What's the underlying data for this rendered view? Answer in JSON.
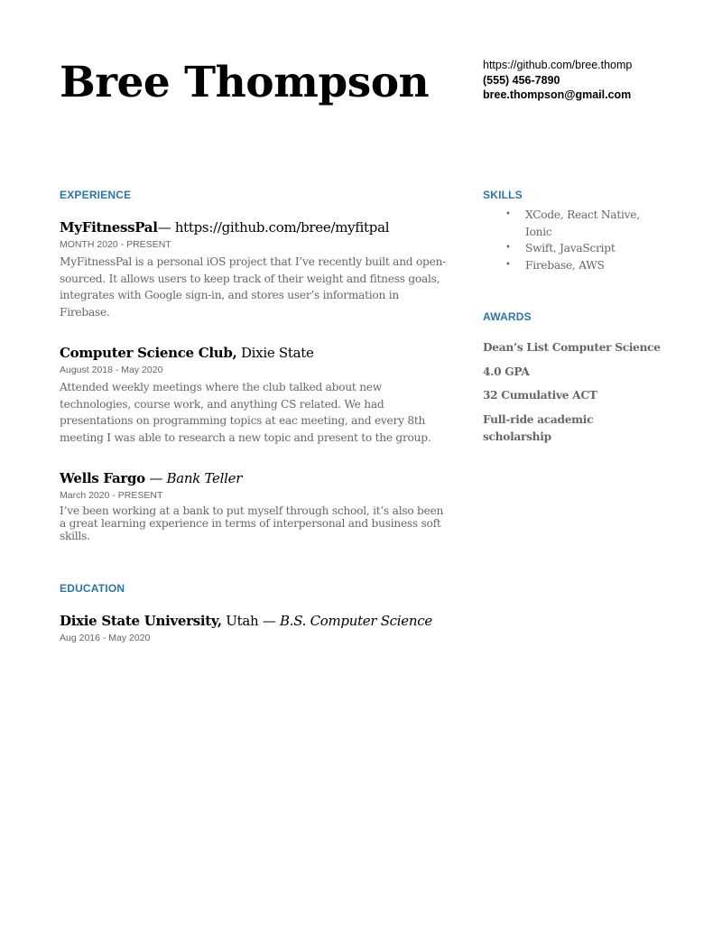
{
  "header": {
    "name": "Bree Thompson",
    "contact": {
      "github": "https://github.com/bree.thomp",
      "phone": "(555) 456-7890",
      "email": "bree.thompson@gmail.com"
    }
  },
  "experience": {
    "title": "EXPERIENCE",
    "entries": [
      {
        "org": "MyFitnessPal",
        "separator": "— ",
        "detail": "https://github.com/bree/myfitpal",
        "date": "MONTH 2020 - PRESENT",
        "description": "MyFitnessPal is a personal iOS project that I’ve recently built and open-sourced. It allows users to keep track of their weight and fitness goals, integrates with Google sign-in, and stores user’s information in Firebase."
      },
      {
        "org": "Computer Science Club,",
        "detail": " Dixie State",
        "date": "August 2018 - May 2020",
        "description": "Attended weekly meetings where the club talked about new technologies, course work, and anything CS related. We had presentations on programming topics at eac meeting, and every 8th meeting I was able to research a new topic and present to the group."
      },
      {
        "org": "Wells Fargo",
        "separator": " — ",
        "role": "Bank Teller",
        "date": "March 2020 - PRESENT",
        "description": "I’ve been working at a bank to put myself through school, it’s also been a great learning experience in terms of interpersonal and business soft skills."
      }
    ]
  },
  "education": {
    "title": "EDUCATION",
    "entries": [
      {
        "school": "Dixie State University,",
        "location": " Utah — ",
        "degree": "B.S. Computer Science",
        "date": "Aug 2016 - May 2020"
      }
    ]
  },
  "skills": {
    "title": "SKILLS",
    "bullet_icon": "•",
    "items": [
      "XCode, React Native, Ionic",
      "Swift, JavaScript",
      "Firebase, AWS"
    ]
  },
  "awards": {
    "title": "AWARDS",
    "items": [
      "Dean’s List Computer Science",
      "4.0 GPA",
      "32 Cumulative ACT",
      "Full-ride academic scholarship"
    ]
  }
}
